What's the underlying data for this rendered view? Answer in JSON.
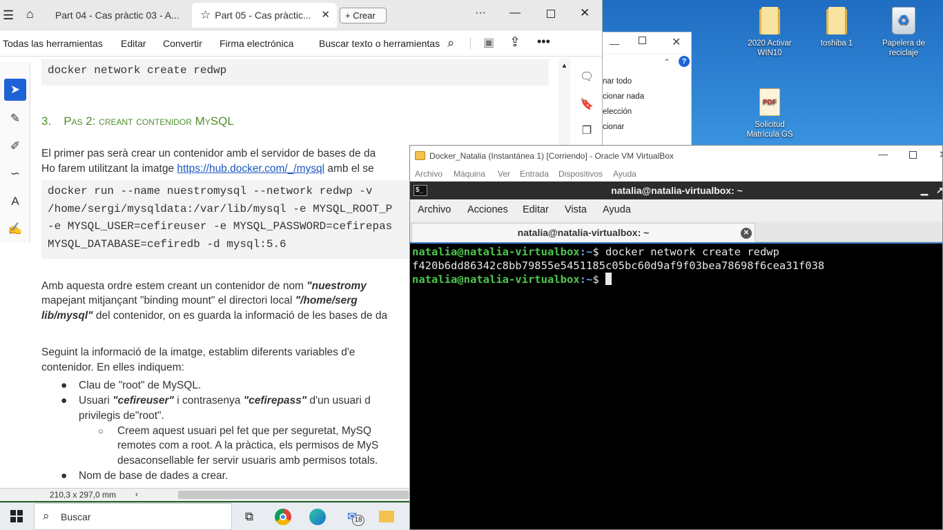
{
  "desktop": {
    "icons": [
      {
        "label": "2020 Activar WIN10",
        "icon": "folder-icon"
      },
      {
        "label": "toshiba 1",
        "icon": "folder-icon"
      },
      {
        "label": "Papelera de reciclaje",
        "icon": "recycle-bin-icon"
      },
      {
        "label": "Solicitud Matrícula GS",
        "icon": "pdf-file-icon"
      }
    ]
  },
  "explorer": {
    "items": [
      "nar todo",
      "cionar nada",
      "elección",
      "cionar"
    ]
  },
  "acrobat": {
    "tabs": [
      {
        "label": "Part 04 - Cas pràctic 03 - A..."
      },
      {
        "label": "Part 05 - Cas pràctic..."
      }
    ],
    "new_tab_label": "Crear",
    "menu": [
      "Todas las herramientas",
      "Editar",
      "Convertir",
      "Firma electrónica"
    ],
    "search_label": "Buscar texto o herramientas",
    "doc": {
      "code1": "docker network create redwp",
      "heading_num": "3.",
      "heading": "Pas 2: creant contenidor MySQL",
      "p1_line1": "El primer pas serà crear un contenidor amb el servidor de bases de da",
      "p1_line2_pre": "Ho farem utilitzant la imatge ",
      "p1_link": "https://hub.docker.com/_/mysql",
      "p1_line2_post": " amb el se",
      "code2": "docker run --name nuestromysql --network redwp -v\n/home/sergi/mysqldata:/var/lib/mysql -e MYSQL_ROOT_P\n-e MYSQL_USER=cefireuser -e MYSQL_PASSWORD=cefirepas\nMYSQL_DATABASE=cefiredb -d mysql:5.6",
      "p2_line1_pre": "Amb aquesta ordre estem creant un contenidor de nom ",
      "p2_line1_b": "\"nuestromy",
      "p2_line2_pre": "mapejant mitjançant \"binding mount\" el directori local ",
      "p2_line2_b": "\"/home/serg",
      "p2_line3_b": "lib/mysql\"",
      "p2_line3_post": " del contenidor, on es guarda la informació de les bases de da",
      "p3_line1": "Seguint la informació de la imatge, establim diferents variables d'e",
      "p3_line2": "contenidor. En elles indiquem:",
      "b1": "Clau de \"root\" de MySQL.",
      "b2_pre": "Usuari ",
      "b2_b1": "\"cefireuser\"",
      "b2_mid": " i contrasenya ",
      "b2_b2": "\"cefirepass\"",
      "b2_post": " d'un usuari d",
      "b2_line2": "privilegis de\"root\".",
      "sub1_line1": "Creem aquest usuari pel fet que per seguretat, MySQ",
      "sub1_line2": "remotes com a root. A la pràctica, els permisos de MyS",
      "sub1_line3": "desaconsellable fer servir usuaris amb permisos totals.",
      "b3": "Nom de base de dades a crear."
    },
    "status_size": "210,3 x 297,0 mm"
  },
  "vbox": {
    "title": "Docker_Natalia (Instantánea 1) [Corriendo] - Oracle VM VirtualBox",
    "menu": [
      "Archivo",
      "Máquina",
      "Ver",
      "Entrada",
      "Dispositivos",
      "Ayuda"
    ],
    "guest_title": "natalia@natalia-virtualbox: ~",
    "guest_menu": [
      "Archivo",
      "Acciones",
      "Editar",
      "Vista",
      "Ayuda"
    ],
    "tab_label": "natalia@natalia-virtualbox: ~",
    "terminal": {
      "prompt_user": "natalia@natalia-virtualbox",
      "prompt_path": ":~",
      "prompt_end": "$ ",
      "command": "docker network create redwp",
      "output": "f420b6dd86342c8bb79855e5451185c05bc60d9af9f03bea78698f6cea31f038"
    }
  },
  "taskbar": {
    "search_label": "Buscar",
    "mail_badge": "18"
  }
}
